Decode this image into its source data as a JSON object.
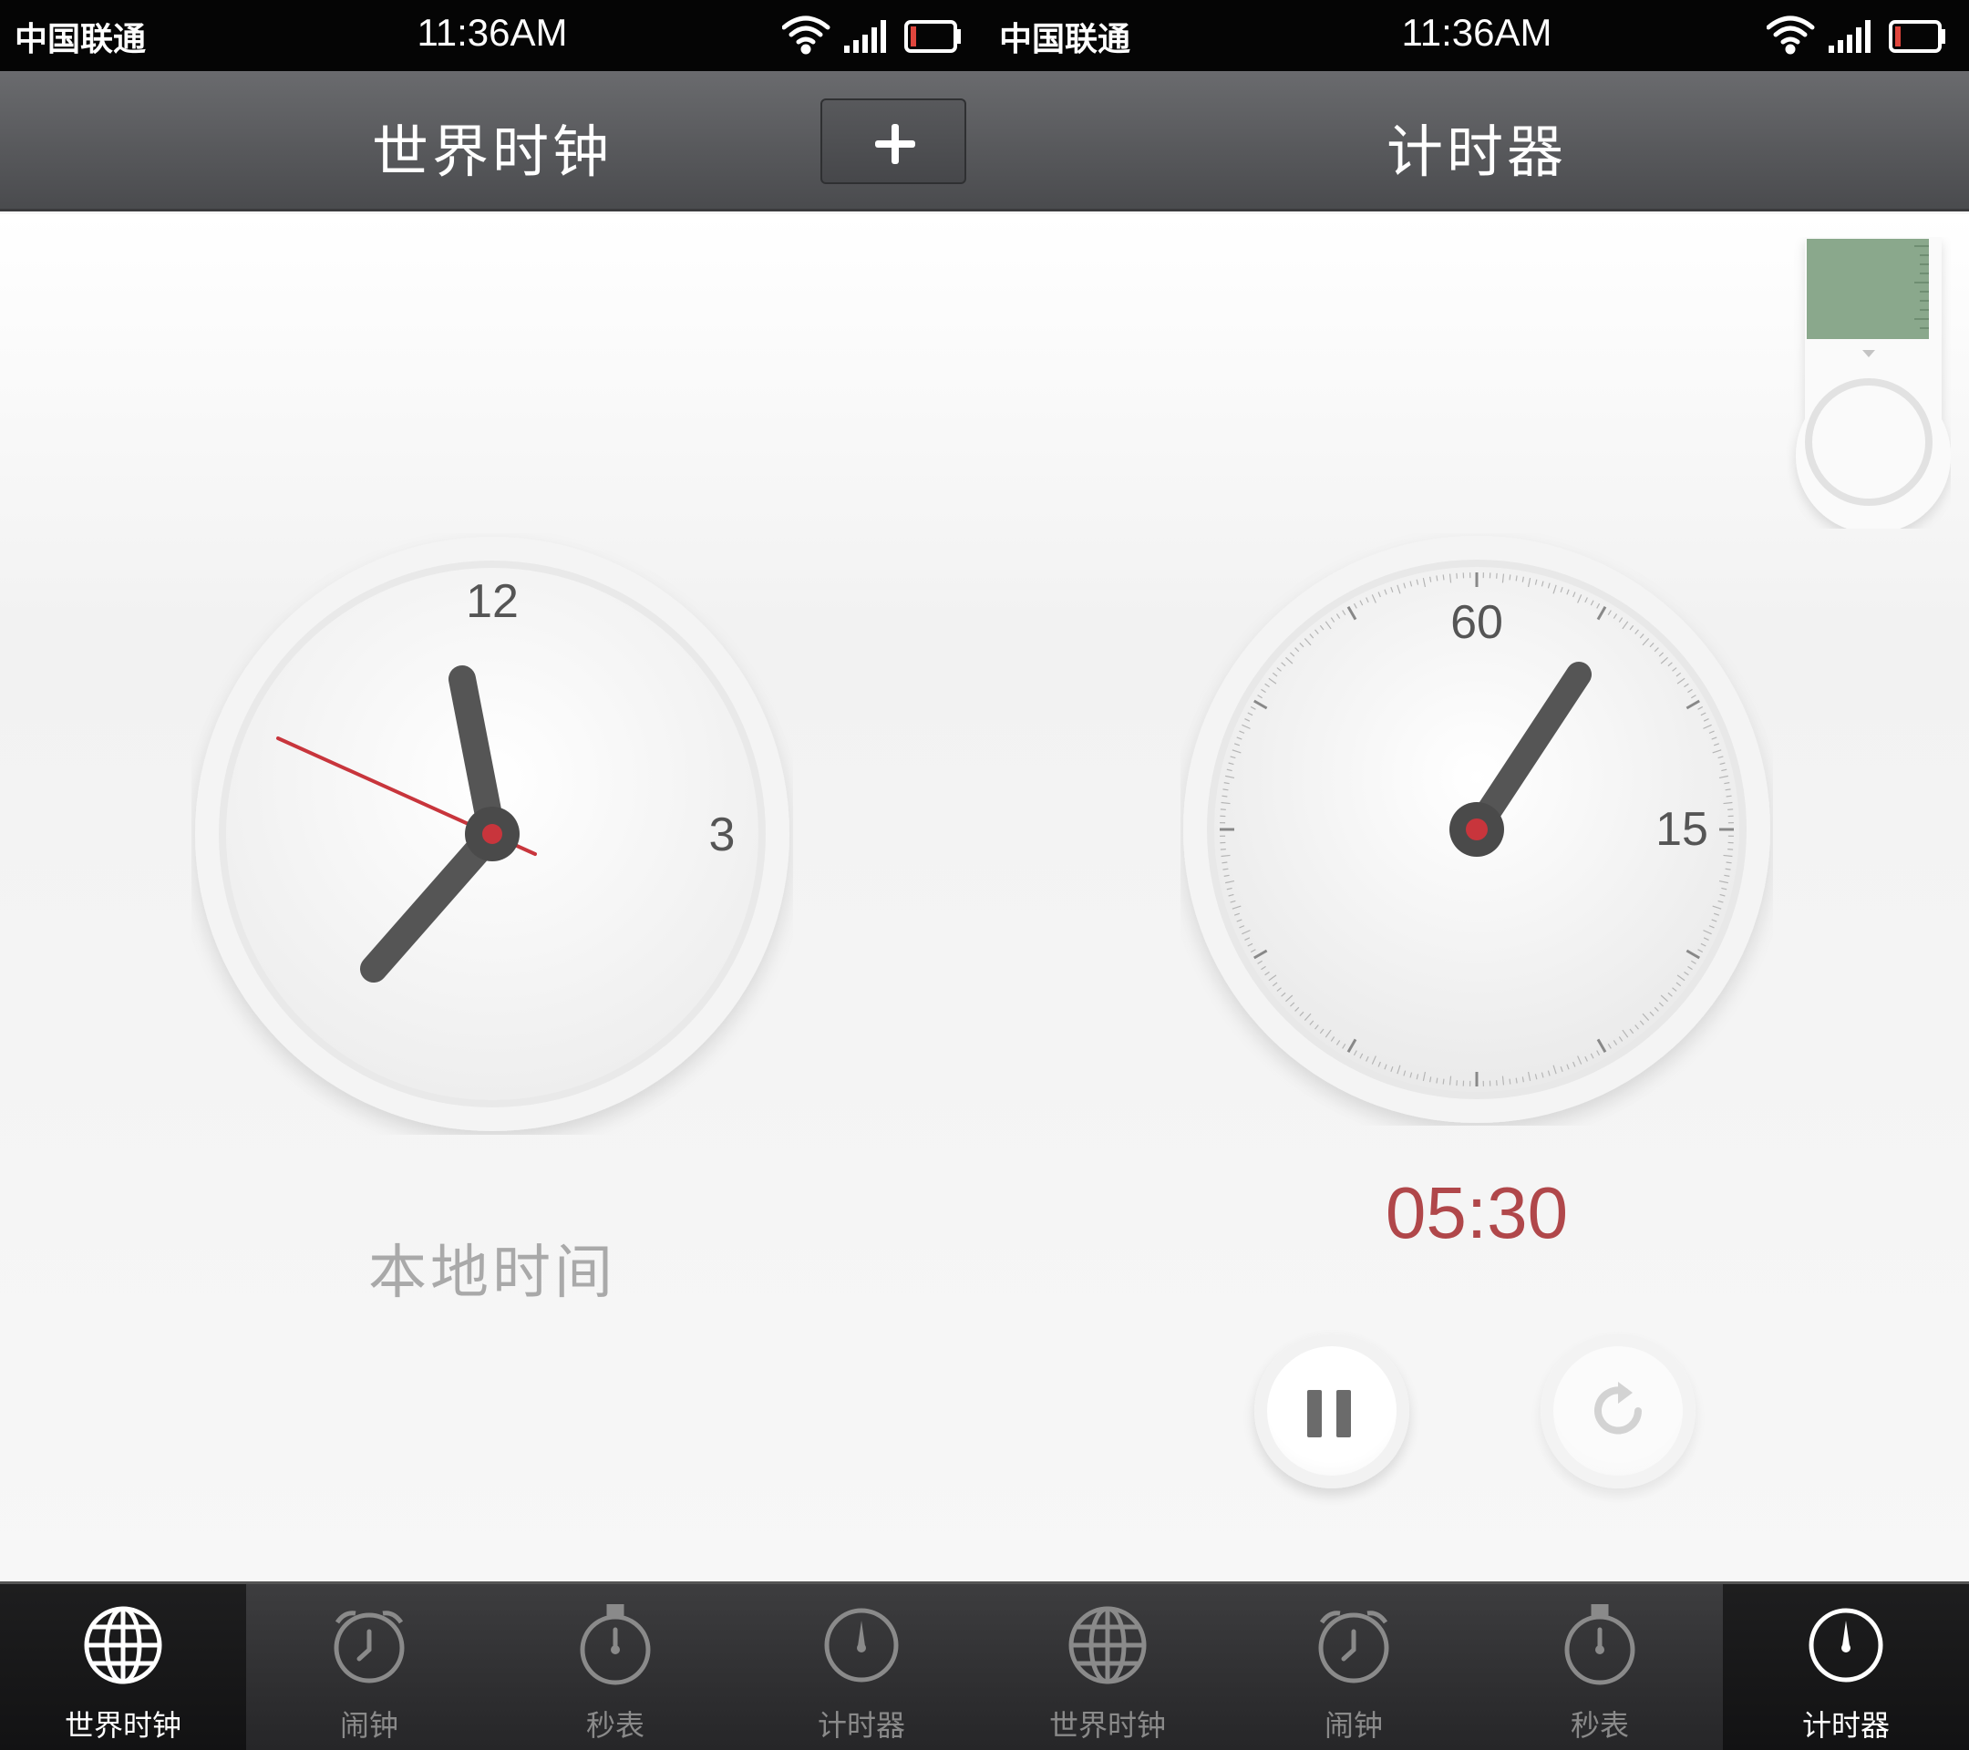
{
  "status_bar": {
    "carrier": "中国联通",
    "time": "11:36AM"
  },
  "world_clock_screen": {
    "title": "世界时钟",
    "clock_numerals": {
      "twelve": "12",
      "three": "3"
    },
    "clock_label": "本地时间"
  },
  "timer_screen": {
    "title": "计时器",
    "dial_numerals": {
      "sixty": "60",
      "fifteen": "15"
    },
    "readout": "05:30"
  },
  "tabs": [
    {
      "label": "世界时钟",
      "icon": "globe-icon"
    },
    {
      "label": "闹钟",
      "icon": "alarm-clock-icon"
    },
    {
      "label": "秒表",
      "icon": "stopwatch-icon"
    },
    {
      "label": "计时器",
      "icon": "timer-icon"
    }
  ],
  "colors": {
    "accent_red": "#b0474a",
    "second_hand": "#c8353c",
    "header_dark": "#4a4b4e",
    "tab_active": "#ffffff",
    "tab_inactive": "#8a8a8a",
    "progress_green": "#8aa88c"
  }
}
